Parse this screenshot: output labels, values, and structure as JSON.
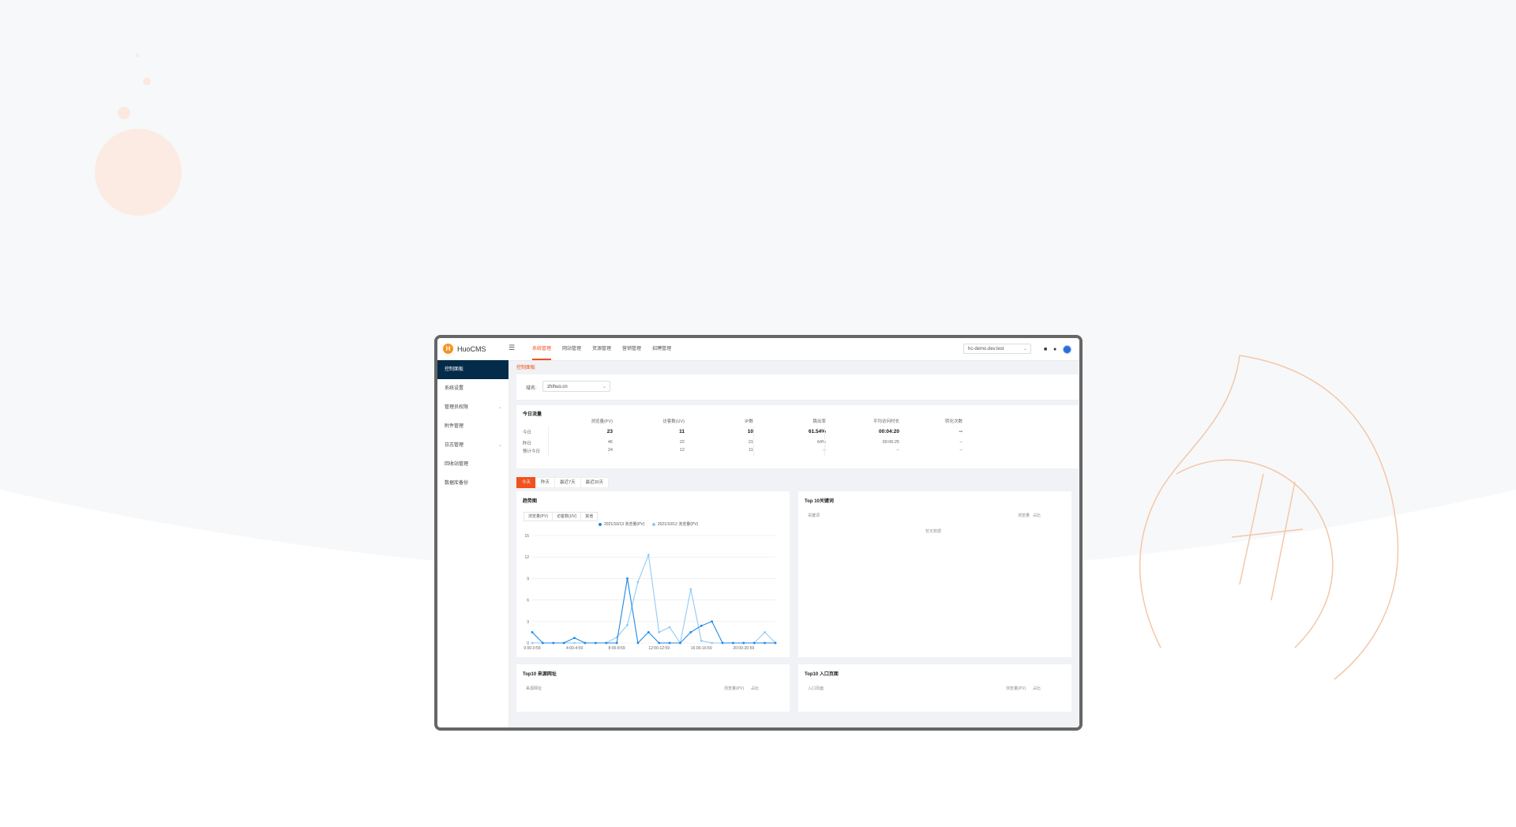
{
  "app": {
    "logo_text": "HuoCMS",
    "logo_glyph": "H"
  },
  "topnav": [
    {
      "label": "系统管理",
      "active": true
    },
    {
      "label": "网站管理",
      "active": false
    },
    {
      "label": "资源管理",
      "active": false
    },
    {
      "label": "营销管理",
      "active": false
    },
    {
      "label": "招聘管理",
      "active": false
    }
  ],
  "header": {
    "domain_value": "hc-demo.dev.test"
  },
  "sidebar": [
    {
      "label": "控制面板",
      "active": true,
      "has_children": false
    },
    {
      "label": "系统设置",
      "active": false,
      "has_children": false
    },
    {
      "label": "管理员权限",
      "active": false,
      "has_children": true
    },
    {
      "label": "附件管理",
      "active": false,
      "has_children": false
    },
    {
      "label": "日志管理",
      "active": false,
      "has_children": true
    },
    {
      "label": "回收站管理",
      "active": false,
      "has_children": false
    },
    {
      "label": "数据库备份",
      "active": false,
      "has_children": false
    }
  ],
  "breadcrumb": "控制面板",
  "domain_filter": {
    "label": "域名:",
    "value": "zhihuo.cn"
  },
  "traffic": {
    "title": "今日流量",
    "columns": [
      "浏览量(PV)",
      "访客数(UV)",
      "IP数",
      "跳出率",
      "平均访问时长",
      "转化次数"
    ],
    "rows": [
      {
        "label": "今日",
        "values": [
          "23",
          "11",
          "10",
          "61.54%",
          "00:04:20",
          "--"
        ]
      },
      {
        "label": "昨日",
        "values": [
          "46",
          "22",
          "21",
          "64%",
          "00:06:25",
          "--"
        ]
      },
      {
        "label": "预计今日",
        "values": [
          "24",
          "12",
          "11",
          "--",
          "--",
          "--"
        ]
      }
    ]
  },
  "range_tabs": [
    {
      "label": "今天",
      "active": true
    },
    {
      "label": "昨天",
      "active": false
    },
    {
      "label": "最近7天",
      "active": false
    },
    {
      "label": "最近30天",
      "active": false
    }
  ],
  "trend": {
    "title": "趋势图",
    "metric_tabs": [
      "浏览量(PV)",
      "访客数(UV)",
      "其他"
    ],
    "colors": {
      "series1": "#1e88e5",
      "series2": "#90caf9",
      "grid": "#e8e8e8"
    }
  },
  "chart_data": {
    "type": "line",
    "x": [
      "0:00-0:59",
      "1:00-1:59",
      "2:00-2:59",
      "3:00-3:59",
      "4:00-4:59",
      "5:00-5:59",
      "6:00-6:59",
      "7:00-7:59",
      "8:00-8:59",
      "9:00-9:59",
      "10:00-10:59",
      "11:00-11:59",
      "12:00-12:59",
      "13:00-13:59",
      "14:00-14:59",
      "15:00-15:59",
      "16:00-16:59",
      "17:00-17:59",
      "18:00-18:59",
      "19:00-19:59",
      "20:00-20:59",
      "21:00-21:59",
      "22:00-22:59",
      "23:00-23:59"
    ],
    "x_tick_labels": [
      "0:00-0:59",
      "4:00-4:59",
      "8:00-8:59",
      "12:00-12:59",
      "16:00-16:59",
      "20:00-20:59"
    ],
    "series": [
      {
        "name": "2021/10/13 浏览量(PV)",
        "values": [
          1.5,
          0,
          0,
          0,
          0.7,
          0,
          0,
          0,
          0,
          9,
          0,
          1.5,
          0,
          0,
          0,
          1.5,
          2.4,
          3,
          0,
          0,
          0,
          0,
          0,
          0
        ]
      },
      {
        "name": "2021/10/12 浏览量(PV)",
        "values": [
          0,
          0,
          0,
          0,
          0,
          0,
          0,
          0,
          0.8,
          2.5,
          8.5,
          12.3,
          1.5,
          2.2,
          0,
          7.5,
          0.3,
          0,
          0,
          0,
          0,
          0,
          1.5,
          0
        ]
      }
    ],
    "y_tick_labels": [
      "0",
      "3",
      "6",
      "9",
      "12",
      "15"
    ],
    "ylim": [
      0,
      15
    ],
    "grid": true
  },
  "keywords": {
    "title": "Top 10关键词",
    "col1": "关键词",
    "col2": "浏览量",
    "col3": "占比",
    "empty": "暂无数据"
  },
  "sources": {
    "title": "Top10 来源网址",
    "col1": "来源网址",
    "col2": "浏览量(PV)",
    "col3": "占比"
  },
  "entries": {
    "title": "Top10 入口页面",
    "col1": "入口页面",
    "col2": "浏览量(PV)",
    "col3": "占比"
  }
}
